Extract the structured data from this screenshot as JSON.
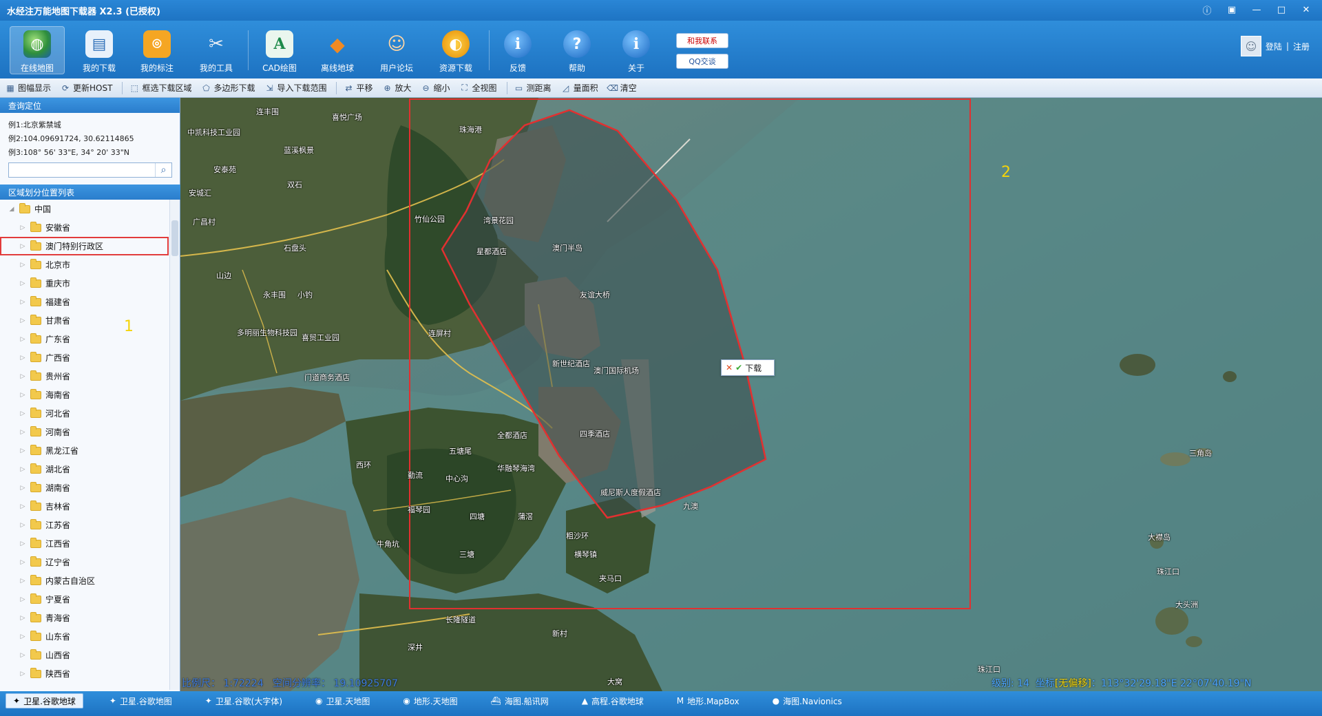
{
  "window": {
    "title": "水经注万能地图下载器 X2.3 (已授权)",
    "controls": [
      "ⓘ",
      "▣",
      "—",
      "□",
      "✕"
    ]
  },
  "ribbon": {
    "buttons": [
      {
        "label": "在线地图",
        "icon": "globe-icon",
        "glyph": "◍"
      },
      {
        "label": "我的下载",
        "icon": "download-list-icon",
        "glyph": "▤"
      },
      {
        "label": "我的标注",
        "icon": "location-pin-icon",
        "glyph": "⌾"
      },
      {
        "label": "我的工具",
        "icon": "tools-icon",
        "glyph": "✂"
      },
      {
        "label": "CAD绘图",
        "icon": "cad-icon",
        "glyph": "A"
      },
      {
        "label": "离线地球",
        "icon": "offline-earth-icon",
        "glyph": "◆"
      },
      {
        "label": "用户论坛",
        "icon": "users-forum-icon",
        "glyph": "☺"
      },
      {
        "label": "资源下载",
        "icon": "resource-download-icon",
        "glyph": "◐"
      },
      {
        "label": "反馈",
        "icon": "feedback-icon",
        "glyph": "i"
      },
      {
        "label": "帮助",
        "icon": "help-icon",
        "glyph": "?"
      },
      {
        "label": "关于",
        "icon": "about-icon",
        "glyph": "i"
      }
    ],
    "contact_label": "和我联系",
    "qq_label": "QQ交谈",
    "login_label": "登陆",
    "separator": "|",
    "register_label": "注册"
  },
  "toolbar": {
    "items": [
      {
        "label": "图幅显示",
        "glyph": "▦"
      },
      {
        "label": "更新HOST",
        "glyph": "⟳"
      },
      {
        "label": "框选下载区域",
        "glyph": "⬚"
      },
      {
        "label": "多边形下载",
        "glyph": "⬠"
      },
      {
        "label": "导入下载范围",
        "glyph": "⇲"
      },
      {
        "label": "平移",
        "glyph": "⇄"
      },
      {
        "label": "放大",
        "glyph": "⊕"
      },
      {
        "label": "缩小",
        "glyph": "⊖"
      },
      {
        "label": "全视图",
        "glyph": "⛶"
      },
      {
        "label": "测距离",
        "glyph": "▭"
      },
      {
        "label": "量面积",
        "glyph": "◿"
      },
      {
        "label": "清空",
        "glyph": "⌫"
      }
    ]
  },
  "left_panel": {
    "search_header": "查询定位",
    "example1": "例1:北京紫禁城",
    "example2": "例2:104.09691724, 30.62114865",
    "example3": "例3:108° 56' 33\"E, 34° 20' 33\"N",
    "search_value": "",
    "region_header": "区域划分位置列表",
    "root": "中国",
    "regions": [
      "安徽省",
      "澳门特别行政区",
      "北京市",
      "重庆市",
      "福建省",
      "甘肃省",
      "广东省",
      "广西省",
      "贵州省",
      "海南省",
      "河北省",
      "河南省",
      "黑龙江省",
      "湖北省",
      "湖南省",
      "吉林省",
      "江苏省",
      "江西省",
      "辽宁省",
      "内蒙古自治区",
      "宁夏省",
      "青海省",
      "山东省",
      "山西省",
      "陕西省"
    ],
    "selected_region": "澳门特别行政区",
    "annotation": "1"
  },
  "map": {
    "annotation": "2",
    "popup_label": "下载",
    "places": [
      {
        "t": "连丰围"
      },
      {
        "t": "喜悦广场"
      },
      {
        "t": "中凯科技工业园"
      },
      {
        "t": "蓝溪枫景"
      },
      {
        "t": "安泰苑"
      },
      {
        "t": "双石"
      },
      {
        "t": "安城汇"
      },
      {
        "t": "广昌村"
      },
      {
        "t": "竹仙公园"
      },
      {
        "t": "石盘头"
      },
      {
        "t": "山边"
      },
      {
        "t": "永丰围"
      },
      {
        "t": "小钓"
      },
      {
        "t": "多明丽生物科技园"
      },
      {
        "t": "喜贸工业园"
      },
      {
        "t": "门道商务酒店"
      },
      {
        "t": "连屏村"
      },
      {
        "t": "珠海港"
      },
      {
        "t": "湾景花园"
      },
      {
        "t": "星都酒店"
      },
      {
        "t": "澳门半岛"
      },
      {
        "t": "友谊大桥"
      },
      {
        "t": "新世纪酒店"
      },
      {
        "t": "澳门国际机场"
      },
      {
        "t": "全都酒店"
      },
      {
        "t": "华融琴海湾"
      },
      {
        "t": "四季酒店"
      },
      {
        "t": "威尼斯人度假酒店"
      },
      {
        "t": "九澳"
      },
      {
        "t": "五塘尾"
      },
      {
        "t": "中心沟"
      },
      {
        "t": "西环"
      },
      {
        "t": "勤流"
      },
      {
        "t": "福琴园"
      },
      {
        "t": "四塘"
      },
      {
        "t": "蒲滘"
      },
      {
        "t": "牛角坑"
      },
      {
        "t": "三塘"
      },
      {
        "t": "粗沙环"
      },
      {
        "t": "横琴镇"
      },
      {
        "t": "夹马口"
      },
      {
        "t": "长隆隧道"
      },
      {
        "t": "深井"
      },
      {
        "t": "新村"
      },
      {
        "t": "大窝"
      },
      {
        "t": "珠江口"
      },
      {
        "t": "三角岛"
      },
      {
        "t": "大襟岛"
      },
      {
        "t": "大头洲"
      },
      {
        "t": "珠江口"
      }
    ],
    "scale_text": "比例尺： 1:72224",
    "resolution_text": "空间分辨率： 19.10925707",
    "level_text": "级别: 14",
    "coord_label": "坐标",
    "coord_tag": "[无偏移]",
    "coord_value": "：113°32'29.18\"E  22°07'40.19\"N"
  },
  "bottom_tabs": [
    {
      "label": "卫星.谷歌地球",
      "icon": "satellite-icon",
      "active": true
    },
    {
      "label": "卫星.谷歌地图",
      "icon": "satellite-icon",
      "active": false
    },
    {
      "label": "卫星.谷歌(大字体)",
      "icon": "satellite-icon",
      "active": false
    },
    {
      "label": "卫星.天地图",
      "icon": "tianditu-icon",
      "active": false
    },
    {
      "label": "地形.天地图",
      "icon": "tianditu-icon",
      "active": false
    },
    {
      "label": "海图.船讯网",
      "icon": "ship-icon",
      "active": false
    },
    {
      "label": "高程.谷歌地球",
      "icon": "elevation-icon",
      "active": false
    },
    {
      "label": "地形.MapBox",
      "icon": "mapbox-icon",
      "active": false
    },
    {
      "label": "海图.Navionics",
      "icon": "navionics-icon",
      "active": false
    }
  ]
}
